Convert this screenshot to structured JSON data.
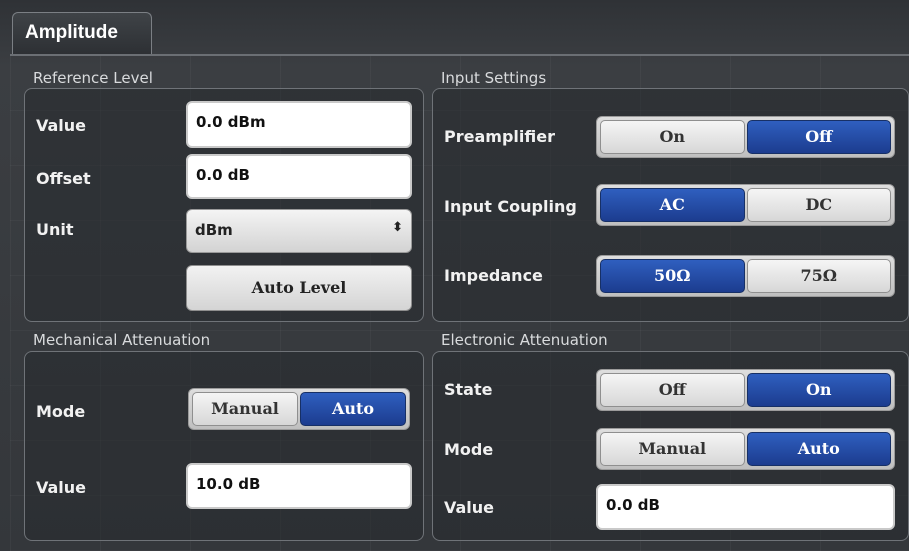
{
  "tab": {
    "label": "Amplitude"
  },
  "reference_level": {
    "title": "Reference Level",
    "value_label": "Value",
    "value": "0.0 dBm",
    "offset_label": "Offset",
    "offset": "0.0 dB",
    "unit_label": "Unit",
    "unit_selected": "dBm",
    "auto_level_label": "Auto Level"
  },
  "input_settings": {
    "title": "Input Settings",
    "preamplifier_label": "Preamplifier",
    "preamplifier_options": [
      "On",
      "Off"
    ],
    "preamplifier_selected": "Off",
    "input_coupling_label": "Input Coupling",
    "input_coupling_options": [
      "AC",
      "DC"
    ],
    "input_coupling_selected": "AC",
    "impedance_label": "Impedance",
    "impedance_options": [
      "50Ω",
      "75Ω"
    ],
    "impedance_selected": "50Ω"
  },
  "mechanical_attenuation": {
    "title": "Mechanical Attenuation",
    "mode_label": "Mode",
    "mode_options": [
      "Manual",
      "Auto"
    ],
    "mode_selected": "Auto",
    "value_label": "Value",
    "value": "10.0 dB"
  },
  "electronic_attenuation": {
    "title": "Electronic Attenuation",
    "state_label": "State",
    "state_options": [
      "Off",
      "On"
    ],
    "state_selected": "On",
    "mode_label": "Mode",
    "mode_options": [
      "Manual",
      "Auto"
    ],
    "mode_selected": "Auto",
    "value_label": "Value",
    "value": "0.0 dB"
  },
  "colors": {
    "active_segment": "#1f3f97",
    "panel_background": "#3a3d40"
  },
  "icons": {
    "select_arrow": "updown-arrows-icon"
  }
}
